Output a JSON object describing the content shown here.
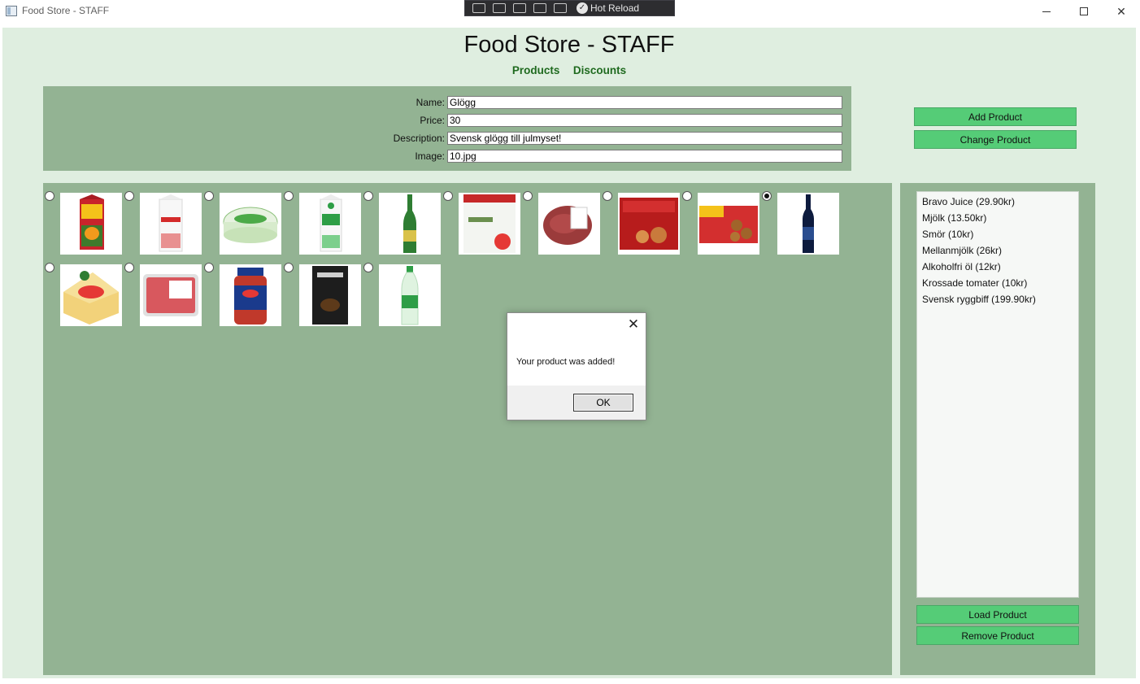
{
  "window": {
    "title": "Food Store - STAFF",
    "devtools_label": "Hot Reload"
  },
  "header": {
    "title": "Food Store - STAFF",
    "nav": [
      {
        "label": "Products"
      },
      {
        "label": "Discounts"
      }
    ]
  },
  "form": {
    "fields": [
      {
        "label": "Name:",
        "value": "Glögg"
      },
      {
        "label": "Price:",
        "value": "30"
      },
      {
        "label": "Description:",
        "value": "Svensk glögg till julmyset!"
      },
      {
        "label": "Image:",
        "value": "10.jpg"
      }
    ]
  },
  "actions": {
    "add_label": "Add Product",
    "change_label": "Change Product",
    "load_label": "Load Product",
    "remove_label": "Remove Product"
  },
  "product_images": [
    {
      "icon": "juice-carton-image",
      "selected": false
    },
    {
      "icon": "milk-carton-image",
      "selected": false
    },
    {
      "icon": "butter-tub-image",
      "selected": false
    },
    {
      "icon": "milk-carton-image",
      "selected": false
    },
    {
      "icon": "beer-bottle-image",
      "selected": false
    },
    {
      "icon": "tomato-package-image",
      "selected": false
    },
    {
      "icon": "beef-steak-image",
      "selected": false
    },
    {
      "icon": "gingerbread-box-image",
      "selected": false
    },
    {
      "icon": "cookie-box-image",
      "selected": false
    },
    {
      "icon": "glogg-bottle-image",
      "selected": true
    },
    {
      "icon": "gouda-cheese-image",
      "selected": false
    },
    {
      "icon": "minced-meat-image",
      "selected": false
    },
    {
      "icon": "pasta-sauce-jar-image",
      "selected": false
    },
    {
      "icon": "coffee-bag-image",
      "selected": false
    },
    {
      "icon": "soda-bottle-image",
      "selected": false
    }
  ],
  "product_list": [
    "Bravo Juice (29.90kr)",
    "Mjölk (13.50kr)",
    "Smör (10kr)",
    "Mellanmjölk (26kr)",
    "Alkoholfri öl (12kr)",
    "Krossade tomater (10kr)",
    "Svensk ryggbiff (199.90kr)"
  ],
  "dialog": {
    "message": "Your product was added!",
    "ok_label": "OK"
  }
}
